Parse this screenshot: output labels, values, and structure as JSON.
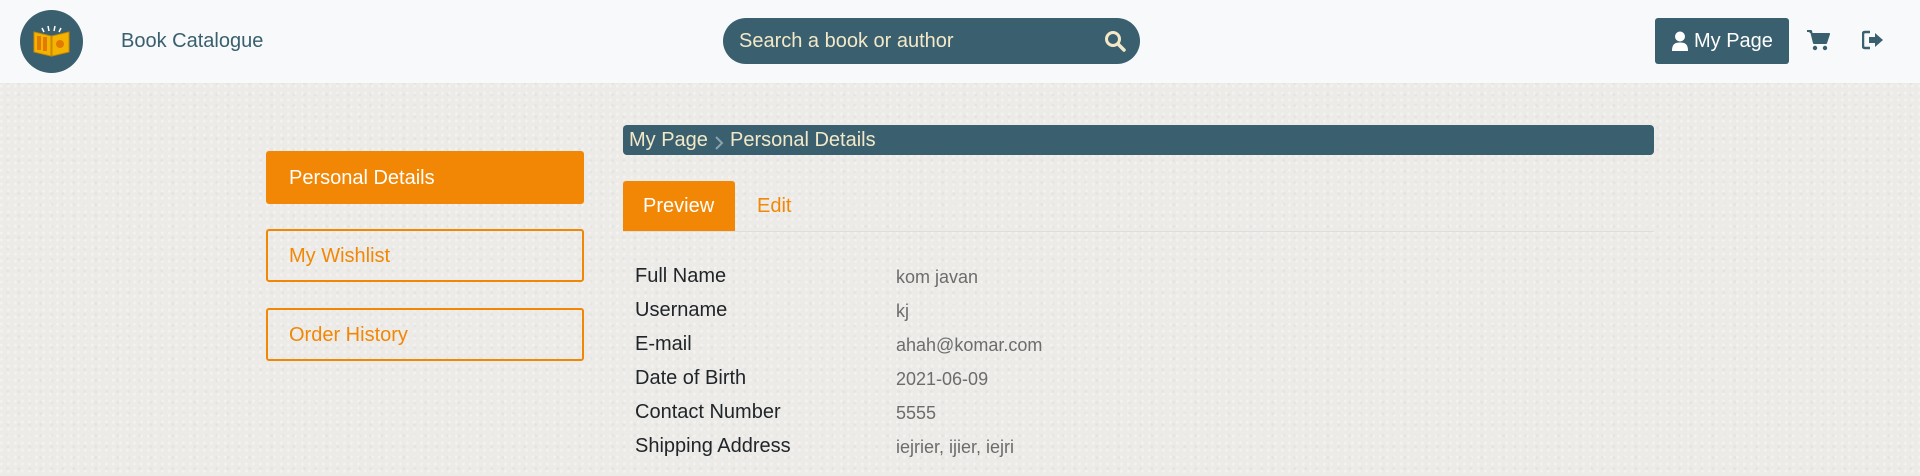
{
  "header": {
    "brand": "Book Catalogue",
    "search_placeholder": "Search a book or author",
    "mypage_label": "My Page",
    "icons": [
      "book-logo-icon",
      "search-icon",
      "user-icon",
      "cart-icon",
      "logout-icon"
    ]
  },
  "sidebar": {
    "items": [
      {
        "label": "Personal Details",
        "active": true
      },
      {
        "label": "My Wishlist",
        "active": false
      },
      {
        "label": "Order History",
        "active": false
      }
    ]
  },
  "breadcrumb": {
    "items": [
      "My Page",
      "Personal Details"
    ]
  },
  "tabs": [
    {
      "label": "Preview",
      "active": true
    },
    {
      "label": "Edit",
      "active": false
    }
  ],
  "details": [
    {
      "label": "Full Name",
      "value": "kom javan"
    },
    {
      "label": "Username",
      "value": "kj"
    },
    {
      "label": "E-mail",
      "value": "ahah@komar.com"
    },
    {
      "label": "Date of Birth",
      "value": "2021-06-09"
    },
    {
      "label": "Contact Number",
      "value": "5555"
    },
    {
      "label": "Shipping Address",
      "value": "iejrier, ijier, iejri"
    }
  ],
  "colors": {
    "primary": "#3a5f6f",
    "accent": "#f28705",
    "search_text": "#f3e9c8"
  }
}
